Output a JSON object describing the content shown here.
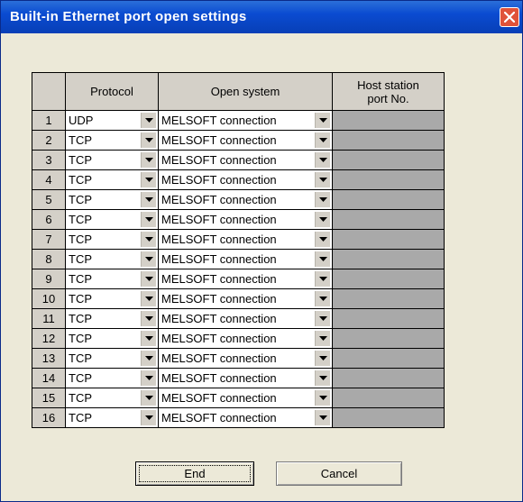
{
  "window": {
    "title": "Built-in Ethernet port open settings"
  },
  "icons": {
    "close": "close-icon",
    "dropdown": "chevron-down-icon"
  },
  "colors": {
    "titlebar": "#0a4bd1",
    "close": "#e0533a",
    "host_cell": "#a9a9a9",
    "dialog_bg": "#ece9d8"
  },
  "table": {
    "headers": {
      "protocol": "Protocol",
      "open_system": "Open system",
      "host_port_line1": "Host station",
      "host_port_line2": "port No."
    },
    "rows": [
      {
        "num": "1",
        "protocol": "UDP",
        "open_system": "MELSOFT connection",
        "host_port": ""
      },
      {
        "num": "2",
        "protocol": "TCP",
        "open_system": "MELSOFT connection",
        "host_port": ""
      },
      {
        "num": "3",
        "protocol": "TCP",
        "open_system": "MELSOFT connection",
        "host_port": ""
      },
      {
        "num": "4",
        "protocol": "TCP",
        "open_system": "MELSOFT connection",
        "host_port": ""
      },
      {
        "num": "5",
        "protocol": "TCP",
        "open_system": "MELSOFT connection",
        "host_port": ""
      },
      {
        "num": "6",
        "protocol": "TCP",
        "open_system": "MELSOFT connection",
        "host_port": ""
      },
      {
        "num": "7",
        "protocol": "TCP",
        "open_system": "MELSOFT connection",
        "host_port": ""
      },
      {
        "num": "8",
        "protocol": "TCP",
        "open_system": "MELSOFT connection",
        "host_port": ""
      },
      {
        "num": "9",
        "protocol": "TCP",
        "open_system": "MELSOFT connection",
        "host_port": ""
      },
      {
        "num": "10",
        "protocol": "TCP",
        "open_system": "MELSOFT connection",
        "host_port": ""
      },
      {
        "num": "11",
        "protocol": "TCP",
        "open_system": "MELSOFT connection",
        "host_port": ""
      },
      {
        "num": "12",
        "protocol": "TCP",
        "open_system": "MELSOFT connection",
        "host_port": ""
      },
      {
        "num": "13",
        "protocol": "TCP",
        "open_system": "MELSOFT connection",
        "host_port": ""
      },
      {
        "num": "14",
        "protocol": "TCP",
        "open_system": "MELSOFT connection",
        "host_port": ""
      },
      {
        "num": "15",
        "protocol": "TCP",
        "open_system": "MELSOFT connection",
        "host_port": ""
      },
      {
        "num": "16",
        "protocol": "TCP",
        "open_system": "MELSOFT connection",
        "host_port": ""
      }
    ]
  },
  "buttons": {
    "end": "End",
    "cancel": "Cancel"
  }
}
